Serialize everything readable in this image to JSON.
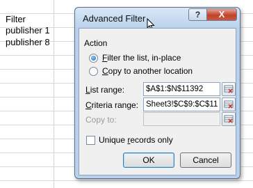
{
  "sheet": {
    "cells": [
      "Filter",
      "publisher 1",
      "publisher 8"
    ]
  },
  "dialog": {
    "title": "Advanced Filter",
    "help_label": "?",
    "close_label": "X",
    "action_label": "Action",
    "radio_filter": {
      "pre": "",
      "access": "F",
      "post": "ilter the list, in-place",
      "selected": true
    },
    "radio_copy": {
      "pre": "",
      "access": "C",
      "post": "opy to another location",
      "selected": false
    },
    "list_range": {
      "label_access": "L",
      "label_rest": "ist range:",
      "value": "$A$1:$N$11392"
    },
    "criteria_range": {
      "label_access": "C",
      "label_rest": "riteria range:",
      "value": "Sheet3!$C$9:$C$11"
    },
    "copy_to": {
      "label": "Copy to:",
      "value": ""
    },
    "unique": {
      "pre": "Unique ",
      "access": "r",
      "post": "ecords only",
      "checked": false
    },
    "ok_label": "OK",
    "cancel_label": "Cancel"
  },
  "colors": {
    "dialog_frame": "#b9d1ea",
    "close_button": "#c0432b",
    "radio_selected": "#1c6fb9"
  }
}
